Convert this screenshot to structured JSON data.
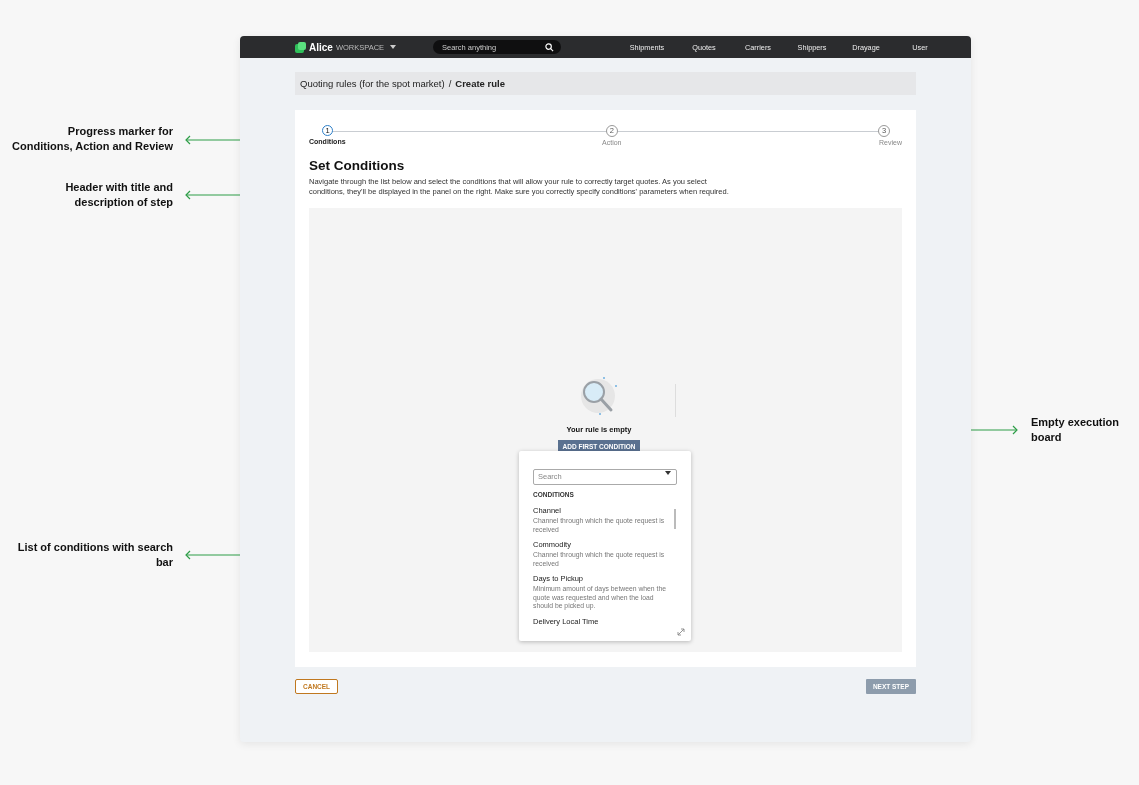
{
  "annotations": [
    {
      "text": "Progress marker for Conditions, Action and Review"
    },
    {
      "text": "Header with title and description of step"
    },
    {
      "text": "Empty execution board"
    },
    {
      "text": "List of conditions with search bar"
    }
  ],
  "nav": {
    "brand": "Alice",
    "product": "WORKSPACE",
    "search": {
      "placeholder": "Search anything"
    },
    "links": [
      "Shipments",
      "Quotes",
      "Carriers",
      "Shippers",
      "Drayage",
      "User"
    ]
  },
  "breadcrumb": {
    "parent": "Quoting rules (for the spot market)",
    "separator": "/",
    "current": "Create rule"
  },
  "steps": [
    {
      "number": "1",
      "label": "Conditions",
      "selected": true
    },
    {
      "number": "2",
      "label": "Action",
      "selected": false
    },
    {
      "number": "3",
      "label": "Review",
      "selected": false
    }
  ],
  "header": {
    "title": "Set Conditions",
    "description": "Navigate through the list below and select the conditions that will allow your rule to correctly target quotes. As you select conditions, they'll be displayed in the panel on the right. Make sure you correctly specify conditions' parameters when required."
  },
  "board": {
    "empty_title": "Your rule is empty",
    "button": "ADD FIRST CONDITION"
  },
  "dropdown": {
    "search": {
      "placeholder": "Search"
    },
    "section": "CONDITIONS",
    "items": [
      {
        "name": "Channel",
        "description": "Channel through which the quote request is received"
      },
      {
        "name": "Commodity",
        "description": "Channel through which the quote request is received"
      },
      {
        "name": "Days to Pickup",
        "description": "Minimum amount of days between when the quote was requested and when the load should be picked up."
      },
      {
        "name": "Delivery Local Time"
      }
    ]
  },
  "footer": {
    "cancel": "CANCEL",
    "next": {
      "label": "NEXT STEP",
      "disabled": true
    }
  }
}
